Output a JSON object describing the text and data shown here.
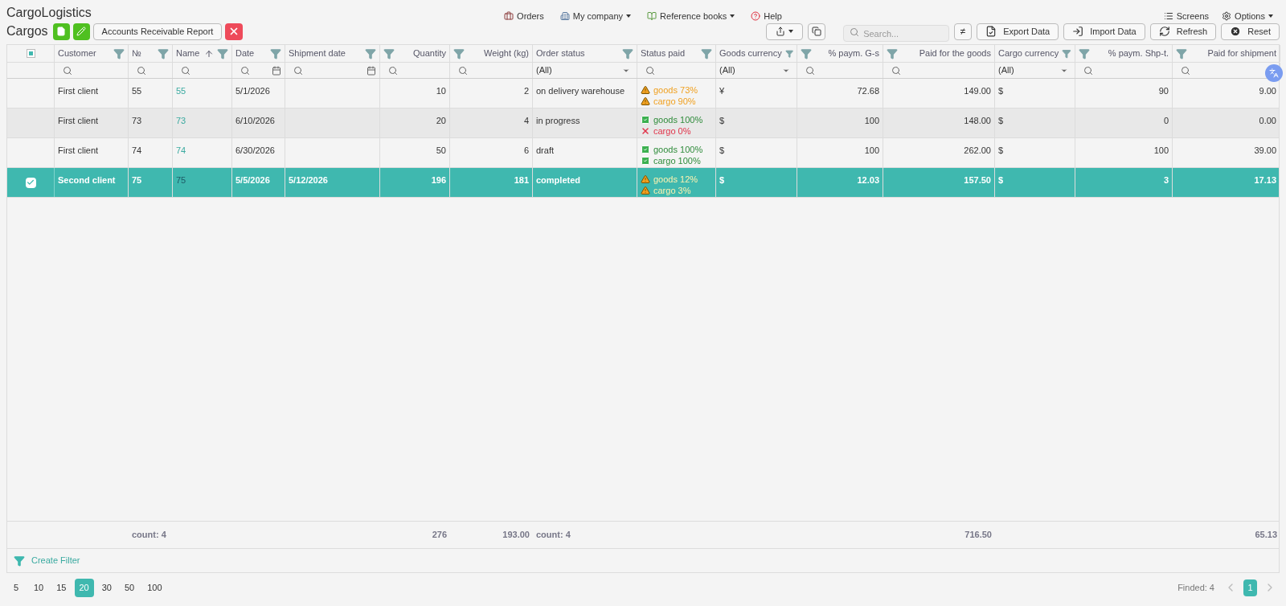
{
  "app": {
    "title": "CargoLogistics"
  },
  "nav": [
    {
      "label": "Orders",
      "dropdown": false
    },
    {
      "label": "My company",
      "dropdown": true
    },
    {
      "label": "Reference books",
      "dropdown": true
    },
    {
      "label": "Help",
      "dropdown": false
    }
  ],
  "nav_right": [
    {
      "label": "Screens",
      "dropdown": false
    },
    {
      "label": "Options",
      "dropdown": true
    }
  ],
  "page": {
    "title": "Cargos",
    "report_button": "Accounts Receivable Report"
  },
  "toolbar": {
    "search_placeholder": "Search...",
    "not_equal_button": "≠",
    "buttons": [
      "Export Data",
      "Import Data",
      "Refresh",
      "Reset"
    ]
  },
  "table": {
    "header_checkbox": {
      "indeterminate": true
    },
    "columns": [
      {
        "label": "Customer",
        "numeric": false,
        "filter": {
          "kind": "search"
        }
      },
      {
        "label": "№",
        "numeric": false,
        "filter": {
          "kind": "search"
        },
        "total": "count: 4"
      },
      {
        "label": "Name",
        "numeric": false,
        "filter": {
          "kind": "search"
        },
        "sorted": true,
        "kind": "link"
      },
      {
        "label": "Date",
        "numeric": false,
        "filter": {
          "kind": "date"
        }
      },
      {
        "label": "Shipment date",
        "numeric": false,
        "filter": {
          "kind": "date"
        }
      },
      {
        "label": "Quantity",
        "numeric": true,
        "filter": {
          "kind": "search"
        },
        "total": "276"
      },
      {
        "label": "Weight (kg)",
        "numeric": true,
        "filter": {
          "kind": "search"
        },
        "total": "193.00"
      },
      {
        "label": "Order status",
        "numeric": false,
        "filter": {
          "kind": "select",
          "value": "(All)"
        },
        "total": "count: 4"
      },
      {
        "label": "Status paid",
        "numeric": false,
        "filter": {
          "kind": "search"
        },
        "kind": "status"
      },
      {
        "label": "Goods currency",
        "numeric": false,
        "filter": {
          "kind": "select",
          "value": "(All)"
        }
      },
      {
        "label": "% paym. G-s",
        "numeric": true,
        "filter": {
          "kind": "search"
        }
      },
      {
        "label": "Paid for the goods",
        "numeric": true,
        "filter": {
          "kind": "search"
        },
        "total": "716.50"
      },
      {
        "label": "Cargo currency",
        "numeric": false,
        "filter": {
          "kind": "select",
          "value": "(All)"
        }
      },
      {
        "label": "% paym. Shp-t.",
        "numeric": true,
        "filter": {
          "kind": "search"
        }
      },
      {
        "label": "Paid for shipment",
        "numeric": true,
        "filter": {
          "kind": "search"
        },
        "total": "65.13"
      }
    ],
    "rows": [
      {
        "selected": false,
        "hovered": false,
        "cells": [
          "First client",
          "55",
          "55",
          "5/1/2026",
          null,
          "10",
          "2",
          "on delivery warehouse",
          [
            {
              "kind": "warning",
              "text": "goods 73%"
            },
            {
              "kind": "warning",
              "text": "cargo 90%"
            }
          ],
          "¥",
          "72.68",
          "149.00",
          "$",
          "90",
          "9.00"
        ]
      },
      {
        "selected": false,
        "hovered": true,
        "cells": [
          "First client",
          "73",
          "73",
          "6/10/2026",
          null,
          "20",
          "4",
          "in progress",
          [
            {
              "kind": "ok",
              "text": "goods 100%"
            },
            {
              "kind": "fail",
              "text": "cargo 0%"
            }
          ],
          "$",
          "100",
          "148.00",
          "$",
          "0",
          "0.00"
        ]
      },
      {
        "selected": false,
        "hovered": false,
        "cells": [
          "First client",
          "74",
          "74",
          "6/30/2026",
          null,
          "50",
          "6",
          "draft",
          [
            {
              "kind": "ok",
              "text": "goods 100%"
            },
            {
              "kind": "ok",
              "text": "cargo 100%"
            }
          ],
          "$",
          "100",
          "262.00",
          "$",
          "100",
          "39.00"
        ]
      },
      {
        "selected": true,
        "hovered": false,
        "cells": [
          "Second client",
          "75",
          "75",
          "5/5/2026",
          "5/12/2026",
          "196",
          "181",
          "completed",
          [
            {
              "kind": "warning",
              "text": "goods 12%"
            },
            {
              "kind": "warning",
              "text": "cargo 3%"
            }
          ],
          "$",
          "12.03",
          "157.50",
          "$",
          "3",
          "17.13"
        ]
      }
    ],
    "create_filter": "Create Filter"
  },
  "pagination": {
    "page_sizes": [
      {
        "label": "5",
        "selected": false
      },
      {
        "label": "10",
        "selected": false
      },
      {
        "label": "15",
        "selected": false
      },
      {
        "label": "20",
        "selected": true
      },
      {
        "label": "30",
        "selected": false
      },
      {
        "label": "50",
        "selected": false
      },
      {
        "label": "100",
        "selected": false
      }
    ],
    "found": "Finded: 4",
    "pages": [
      {
        "label": "1",
        "selected": true
      }
    ]
  }
}
